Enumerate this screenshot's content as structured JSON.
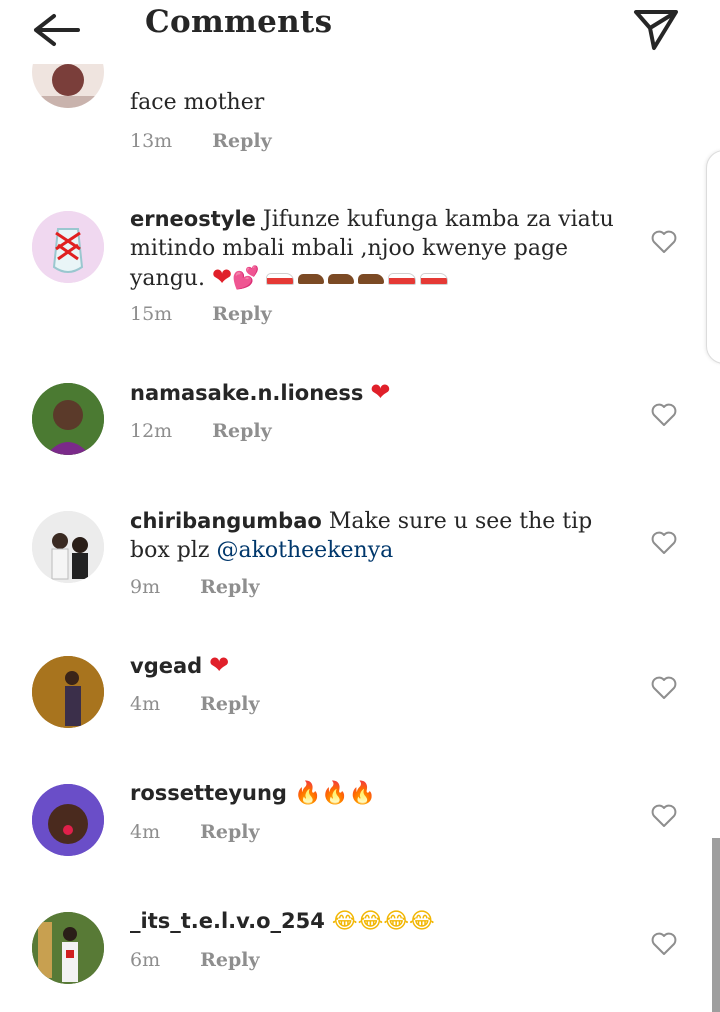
{
  "header": {
    "title": "Comments",
    "back_icon": "arrow-left-icon",
    "send_icon": "paper-plane-icon"
  },
  "reply_label": "Reply",
  "comments": [
    {
      "username": "",
      "text": "face mother",
      "time": "13m"
    },
    {
      "username": "erneostyle",
      "text": "Jifunze kufunga kamba za viatu mitindo mbali mbali ,njoo kwenye page yangu.",
      "emoji": [
        "red-heart",
        "two-hearts",
        "sneaker",
        "mans-shoe",
        "mans-shoe",
        "mans-shoe",
        "sneaker",
        "sneaker"
      ],
      "time": "15m"
    },
    {
      "username": "namasake.n.lioness",
      "text": "",
      "emoji": [
        "red-heart"
      ],
      "time": "12m"
    },
    {
      "username": "chiribangumbao",
      "text": "Make sure u see the tip box plz",
      "mention": "@akotheekenya",
      "time": "9m"
    },
    {
      "username": "vgead",
      "text": "",
      "emoji": [
        "red-heart"
      ],
      "time": "4m"
    },
    {
      "username": "rossetteyung",
      "text": "",
      "emoji": [
        "fire",
        "fire",
        "fire"
      ],
      "time": "4m"
    },
    {
      "username": "_its_t.e.l.v.o_254",
      "text": "",
      "emoji": [
        "laughing-tears",
        "laughing-tears",
        "laughing-tears",
        "laughing-tears"
      ],
      "time": "6m"
    }
  ],
  "colors": {
    "text": "#262626",
    "meta": "#8e8e8e",
    "mention": "#00376b",
    "background": "#ffffff"
  }
}
